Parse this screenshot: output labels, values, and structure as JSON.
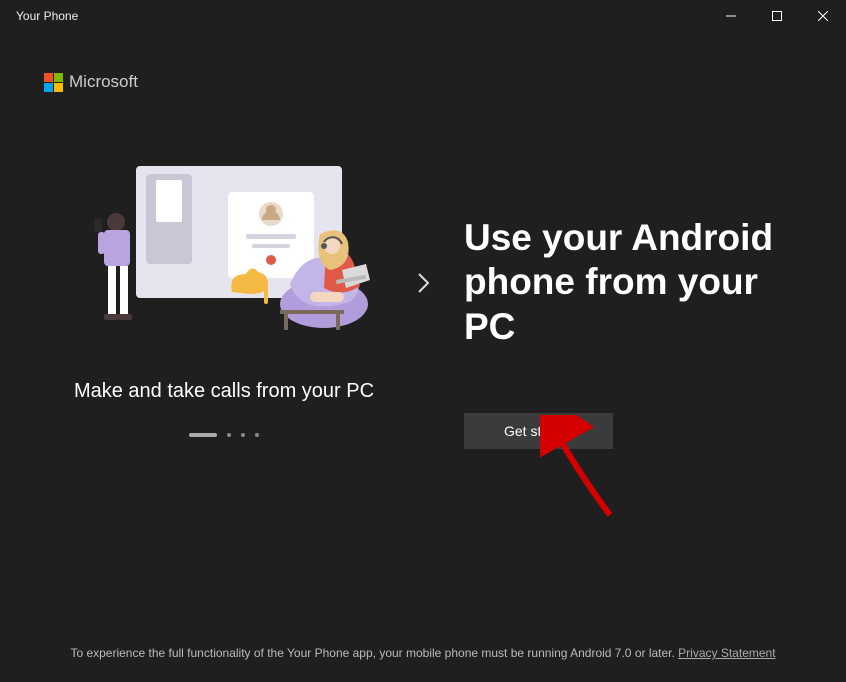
{
  "titlebar": {
    "title": "Your Phone"
  },
  "brand": {
    "name": "Microsoft"
  },
  "hero": {
    "caption": "Make and take calls from your PC",
    "heading": "Use your Android phone from your PC",
    "cta_label": "Get started"
  },
  "footer": {
    "text": "To experience the full functionality of the Your Phone app, your mobile phone must be running Android 7.0 or later. ",
    "link_label": "Privacy Statement"
  },
  "colors": {
    "ms_red": "#f25022",
    "ms_green": "#7fba00",
    "ms_blue": "#00a4ef",
    "ms_yellow": "#ffb900"
  }
}
